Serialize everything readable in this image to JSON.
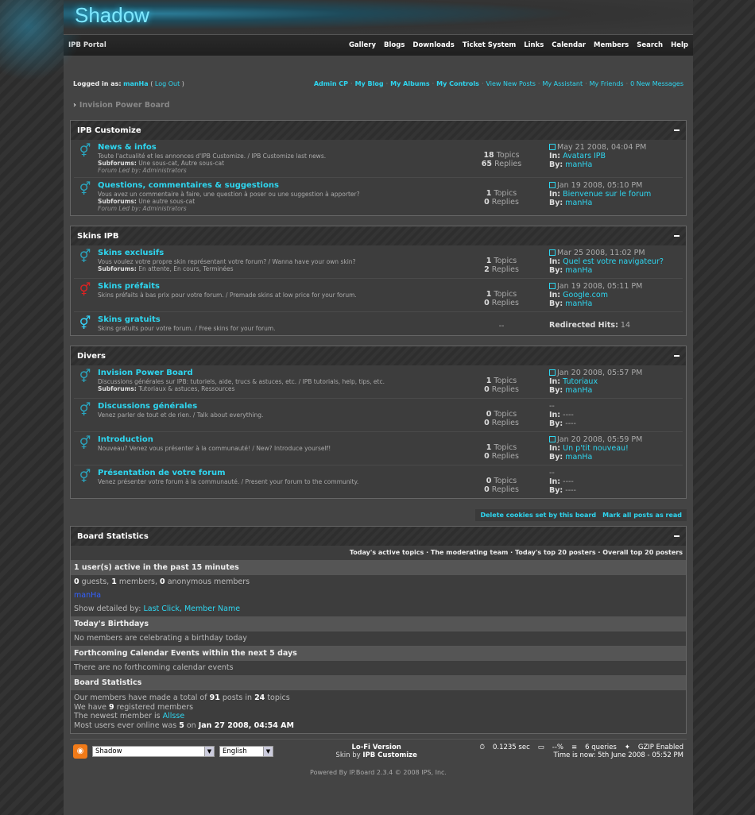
{
  "logo": "Shadow",
  "nav": {
    "portal": "IPB Portal",
    "links": [
      "Gallery",
      "Blogs",
      "Downloads",
      "Ticket System",
      "Links",
      "Calendar",
      "Members",
      "Search",
      "Help"
    ]
  },
  "user": {
    "prefix": "Logged in as:",
    "name": "manHa",
    "logout": "Log Out",
    "controls": [
      "Admin CP",
      "My Blog",
      "My Albums",
      "My Controls",
      "View New Posts",
      "My Assistant",
      "My Friends",
      "0 New Messages"
    ]
  },
  "breadcrumb": "Invision Power Board",
  "categories": [
    {
      "title": "IPB Customize",
      "forums": [
        {
          "name": "News & infos",
          "desc": "Toute l'actualité et les annonces d'IPB Customize. / IPB Customize last news.",
          "sub_label": "Subforums:",
          "sub": "Une sous-cat, Autre sous-cat",
          "led": "Forum Led by: Administrators",
          "topics": "18",
          "replies": "65",
          "date": "May 21 2008, 04:04 PM",
          "in": "Avatars IPB",
          "by": "manHa",
          "icon": "plain"
        },
        {
          "name": "Questions, commentaires & suggestions",
          "desc": "Vous avez un commentaire à faire, une question à poser ou une suggestion à apporter?",
          "sub_label": "Subforums:",
          "sub": "Une autre sous-cat",
          "led": "Forum Led by: Administrators",
          "topics": "1",
          "replies": "0",
          "date": "Jan 19 2008, 05:10 PM",
          "in": "Bienvenue sur le forum",
          "by": "manHa",
          "icon": "plain"
        }
      ]
    },
    {
      "title": "Skins IPB",
      "forums": [
        {
          "name": "Skins exclusifs",
          "desc": "Vous voulez votre propre skin représentant votre forum? / Wanna have your own skin?",
          "sub_label": "Subforums:",
          "sub": "En attente, En cours, Terminées",
          "topics": "1",
          "replies": "2",
          "date": "Mar 25 2008, 11:02 PM",
          "in": "Quel est votre navigateur?",
          "by": "manHa",
          "icon": "plain"
        },
        {
          "name": "Skins préfaits",
          "desc": "Skins préfaits à bas prix pour votre forum. / Premade skins at low price for your forum.",
          "topics": "1",
          "replies": "0",
          "date": "Jan 19 2008, 05:11 PM",
          "in": "Google.com",
          "by": "manHa",
          "icon": "red"
        },
        {
          "name": "Skins gratuits",
          "desc": "Skins gratuits pour votre forum. / Free skins for your forum.",
          "redirect": "--",
          "redirect_label": "Redirected Hits:",
          "redirect_hits": "14",
          "icon": "bright"
        }
      ]
    },
    {
      "title": "Divers",
      "forums": [
        {
          "name": "Invision Power Board",
          "desc": "Discussions générales sur IPB: tutoriels, aide, trucs & astuces, etc. / IPB tutorials, help, tips, etc.",
          "sub_label": "Subforums:",
          "sub": "Tutoriaux & astuces, Ressources",
          "topics": "1",
          "replies": "0",
          "date": "Jan 20 2008, 05:57 PM",
          "in": "Tutoriaux",
          "by": "manHa",
          "icon": "plain"
        },
        {
          "name": "Discussions générales",
          "desc": "Venez parler de tout et de rien. / Talk about everything.",
          "topics": "0",
          "replies": "0",
          "date": "--",
          "in": "----",
          "by": "----",
          "icon": "plain",
          "empty": true
        },
        {
          "name": "Introduction",
          "desc": "Nouveau? Venez vous présenter à la communauté! / New? Introduce yourself!",
          "topics": "1",
          "replies": "0",
          "date": "Jan 20 2008, 05:59 PM",
          "in": "Un p'tit nouveau!",
          "by": "manHa",
          "icon": "plain"
        },
        {
          "name": "Présentation de votre forum",
          "desc": "Venez présenter votre forum à la communauté. / Present your forum to the community.",
          "topics": "0",
          "replies": "0",
          "date": "--",
          "in": "----",
          "by": "----",
          "icon": "plain",
          "empty": true
        }
      ]
    }
  ],
  "labels": {
    "topics": "Topics",
    "replies": "Replies",
    "in": "In:",
    "by": "By:"
  },
  "actions": [
    "Delete cookies set by this board",
    "Mark all posts as read"
  ],
  "stats": {
    "title": "Board Statistics",
    "links": "Today's active topics · The moderating team · Today's top 20 posters · Overall top 20 posters",
    "active_head": "1 user(s) active in the past 15 minutes",
    "active_guests": "0",
    "active_members": "1",
    "active_anon": "0",
    "guests_label": "guests,",
    "members_label": "members,",
    "anon_label": "anonymous members",
    "active_user": "manHa",
    "detail_label": "Show detailed by:",
    "detail_links": "Last Click, Member Name",
    "birthday_head": "Today's Birthdays",
    "birthday_text": "No members are celebrating a birthday today",
    "calendar_head": "Forthcoming Calendar Events within the next 5 days",
    "calendar_text": "There are no forthcoming calendar events",
    "board_head": "Board Statistics",
    "posts_line_a": "Our members have made a total of",
    "posts": "91",
    "posts_line_b": "posts in",
    "topics": "24",
    "posts_line_c": "topics",
    "reg_a": "We have",
    "registered": "9",
    "reg_b": "registered members",
    "newest_a": "The newest member is",
    "newest": "Allsse",
    "online_a": "Most users ever online was",
    "online": "5",
    "online_b": "on",
    "online_date": "Jan 27 2008, 04:54 AM"
  },
  "footer": {
    "skin": "Shadow",
    "lang": "English",
    "lofi": "Lo-Fi Version",
    "skin_by_a": "Skin by",
    "skin_by": "IPB Customize",
    "time": "0.1235 sec",
    "pct": "--%",
    "queries": "6 queries",
    "gzip": "GZIP Enabled",
    "now": "Time is now: 5th June 2008 - 05:52 PM",
    "powered": "Powered By IP.Board 2.3.4 © 2008  IPS, Inc."
  }
}
